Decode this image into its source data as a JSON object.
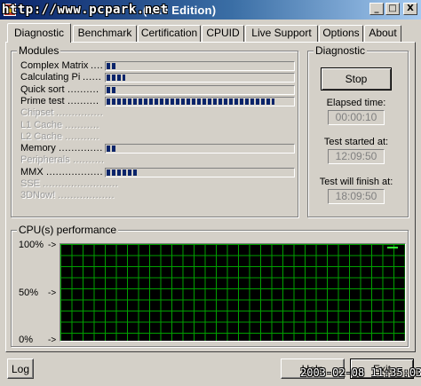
{
  "window": {
    "title_visible": "(Lite Edition)",
    "controls": {
      "minimize": "_",
      "maximize": "□",
      "close": "X"
    }
  },
  "tabs": [
    {
      "label": "Diagnostic",
      "active": true
    },
    {
      "label": "Benchmark",
      "active": false
    },
    {
      "label": "Certification",
      "active": false
    },
    {
      "label": "CPUID",
      "active": false
    },
    {
      "label": "Live Support",
      "active": false
    },
    {
      "label": "Options",
      "active": false
    },
    {
      "label": "About",
      "active": false
    }
  ],
  "modules": {
    "title": "Modules",
    "items": [
      {
        "label": "Complex Matrix",
        "dots": "....",
        "enabled": true,
        "progress": 0.05
      },
      {
        "label": "Calculating Pi",
        "dots": "......",
        "enabled": true,
        "progress": 0.1
      },
      {
        "label": "Quick sort",
        "dots": "..........",
        "enabled": true,
        "progress": 0.05
      },
      {
        "label": "Prime test",
        "dots": "..........",
        "enabled": true,
        "progress": 0.9
      },
      {
        "label": "Chipset",
        "dots": "...............",
        "enabled": false,
        "progress": null
      },
      {
        "label": "L1 Cache",
        "dots": "...........",
        "enabled": false,
        "progress": null
      },
      {
        "label": "L2 Cache",
        "dots": "...........",
        "enabled": false,
        "progress": null
      },
      {
        "label": "Memory",
        "dots": "..............",
        "enabled": true,
        "progress": 0.05
      },
      {
        "label": "Peripherals",
        "dots": "..........",
        "enabled": false,
        "progress": null
      },
      {
        "label": "MMX",
        "dots": ".......................",
        "enabled": true,
        "progress": 0.17
      },
      {
        "label": "SSE",
        "dots": "........................",
        "enabled": false,
        "progress": null
      },
      {
        "label": "3DNow!",
        "dots": "..................",
        "enabled": false,
        "progress": null
      }
    ]
  },
  "diagnostic": {
    "title": "Diagnostic",
    "stop_label": "Stop",
    "elapsed_label": "Elapsed time:",
    "elapsed_value": "00:00:10",
    "started_label": "Test started at:",
    "started_value": "12:09:50",
    "finish_label": "Test will finish at:",
    "finish_value": "18:09:50"
  },
  "cpu_performance": {
    "title": "CPU(s) performance",
    "labels": [
      "100%",
      "50%",
      "0%"
    ],
    "arrow": "->",
    "colors": {
      "background": "#000000",
      "grid": "#00a000",
      "line": "#33ff33"
    }
  },
  "buttons": {
    "log": "Log",
    "help": "Help",
    "exit": "Exit"
  },
  "watermarks": {
    "url": "http://www.pcpark.net",
    "date": "2003-02-08 11:35:03"
  }
}
